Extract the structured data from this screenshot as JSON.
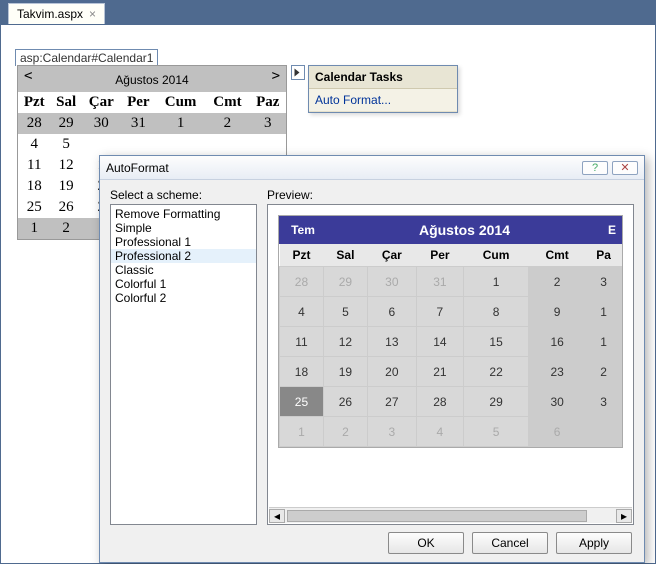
{
  "tab": {
    "label": "Takvim.aspx"
  },
  "selection_tag": "asp:Calendar#Calendar1",
  "bg_calendar": {
    "title": "Ağustos 2014",
    "prev": "<",
    "next": ">",
    "days": [
      "Pzt",
      "Sal",
      "Çar",
      "Per",
      "Cum",
      "Cmt",
      "Paz"
    ],
    "rows": [
      [
        "28",
        "29",
        "30",
        "31",
        "1",
        "2",
        "3"
      ],
      [
        "4",
        "5",
        "",
        "",
        "",
        "",
        ""
      ],
      [
        "11",
        "12",
        "1",
        "",
        "",
        "",
        ""
      ],
      [
        "18",
        "19",
        "2",
        "",
        "",
        "",
        ""
      ],
      [
        "25",
        "26",
        "2",
        "",
        "",
        "",
        ""
      ],
      [
        "1",
        "2",
        "",
        "",
        "",
        "",
        ""
      ]
    ]
  },
  "smart": {
    "title": "Calendar Tasks",
    "items": [
      "Auto Format..."
    ]
  },
  "dialog": {
    "title": "AutoFormat",
    "labels": {
      "scheme": "Select a scheme:",
      "preview": "Preview:"
    },
    "schemes": [
      "Remove Formatting",
      "Simple",
      "Professional 1",
      "Professional 2",
      "Classic",
      "Colorful 1",
      "Colorful 2"
    ],
    "selected_scheme": "Professional 2",
    "buttons": {
      "ok": "OK",
      "cancel": "Cancel",
      "apply": "Apply"
    }
  },
  "preview": {
    "prev_label": "Tem",
    "next_label": "E",
    "title": "Ağustos 2014",
    "days": [
      "Pzt",
      "Sal",
      "Çar",
      "Per",
      "Cum",
      "Cmt",
      "Pa"
    ],
    "grid": [
      [
        {
          "v": "28",
          "o": 1
        },
        {
          "v": "29",
          "o": 1
        },
        {
          "v": "30",
          "o": 1
        },
        {
          "v": "31",
          "o": 1
        },
        {
          "v": "1",
          "o": 0
        },
        {
          "v": "2",
          "o": 0,
          "wk": 1
        },
        {
          "v": "3",
          "o": 0,
          "wk": 1
        }
      ],
      [
        {
          "v": "4",
          "o": 0
        },
        {
          "v": "5",
          "o": 0
        },
        {
          "v": "6",
          "o": 0
        },
        {
          "v": "7",
          "o": 0
        },
        {
          "v": "8",
          "o": 0
        },
        {
          "v": "9",
          "o": 0,
          "wk": 1
        },
        {
          "v": "1",
          "o": 0,
          "wk": 1
        }
      ],
      [
        {
          "v": "11",
          "o": 0
        },
        {
          "v": "12",
          "o": 0
        },
        {
          "v": "13",
          "o": 0
        },
        {
          "v": "14",
          "o": 0
        },
        {
          "v": "15",
          "o": 0
        },
        {
          "v": "16",
          "o": 0,
          "wk": 1
        },
        {
          "v": "1",
          "o": 0,
          "wk": 1
        }
      ],
      [
        {
          "v": "18",
          "o": 0
        },
        {
          "v": "19",
          "o": 0
        },
        {
          "v": "20",
          "o": 0
        },
        {
          "v": "21",
          "o": 0
        },
        {
          "v": "22",
          "o": 0
        },
        {
          "v": "23",
          "o": 0,
          "wk": 1
        },
        {
          "v": "2",
          "o": 0,
          "wk": 1
        }
      ],
      [
        {
          "v": "25",
          "o": 0,
          "t": 1
        },
        {
          "v": "26",
          "o": 0
        },
        {
          "v": "27",
          "o": 0
        },
        {
          "v": "28",
          "o": 0
        },
        {
          "v": "29",
          "o": 0
        },
        {
          "v": "30",
          "o": 0,
          "wk": 1
        },
        {
          "v": "3",
          "o": 0,
          "wk": 1
        }
      ],
      [
        {
          "v": "1",
          "o": 1
        },
        {
          "v": "2",
          "o": 1
        },
        {
          "v": "3",
          "o": 1
        },
        {
          "v": "4",
          "o": 1
        },
        {
          "v": "5",
          "o": 1
        },
        {
          "v": "6",
          "o": 1,
          "wk": 1
        },
        {
          "v": "",
          "o": 1,
          "wk": 1
        }
      ]
    ]
  }
}
